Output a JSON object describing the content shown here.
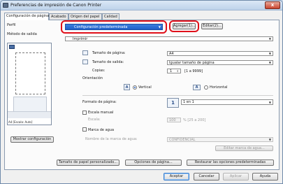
{
  "window": {
    "title": "Preferencias de impresión de Canon Printer",
    "close_glyph": "x"
  },
  "tabs": [
    {
      "label": "Configuración de página"
    },
    {
      "label": "Acabado"
    },
    {
      "label": "Origen del papel"
    },
    {
      "label": "Calidad"
    }
  ],
  "profile": {
    "label": "Perfil",
    "value": "Configuración predeterminada",
    "add_button": "Agregar(1)...",
    "edit_button": "Editar(2)..."
  },
  "output_method": {
    "label": "Método de salida",
    "value": "Imprimir"
  },
  "paper": {
    "page_size_label": "Tamaño de página:",
    "page_size_value": "A4",
    "output_size_label": "Tamaño de salida:",
    "output_size_value": "Igualar tamaño de página",
    "copies_label": "Copias:",
    "copies_value": "1",
    "copies_range": "[1 a 9999]"
  },
  "orientation": {
    "label": "Orientación",
    "vertical": "Vertical",
    "horizontal": "Horizontal",
    "icon_glyph": "A"
  },
  "page_layout": {
    "label": "Formato de página:",
    "icon_value": "1",
    "value": "1 en 1"
  },
  "manual_scale": {
    "label": "Escala manual",
    "scale_label": "Escala:",
    "value": "100",
    "range": "% [25 a 200]"
  },
  "watermark": {
    "label": "Marca de agua",
    "name_label": "Nombre de la marca de agua:",
    "value": "CONFIDENCIAL",
    "edit_button": "Editar marca de agua..."
  },
  "preview": {
    "caption": "A4 [Escala: Auto]",
    "show_button": "Mostrar configuración"
  },
  "bottom_buttons": {
    "custom_paper": "Tamaño de papel personalizado...",
    "page_options": "Opciones de página...",
    "restore_defaults": "Restaurar las opciones predeterminadas"
  },
  "dialog_buttons": {
    "ok": "Aceptar",
    "cancel": "Cancelar",
    "apply": "Aplicar",
    "help": "Ayuda"
  },
  "colors": {
    "highlight_ring": "#e0101a",
    "selection_blue": "#2f73d9"
  }
}
